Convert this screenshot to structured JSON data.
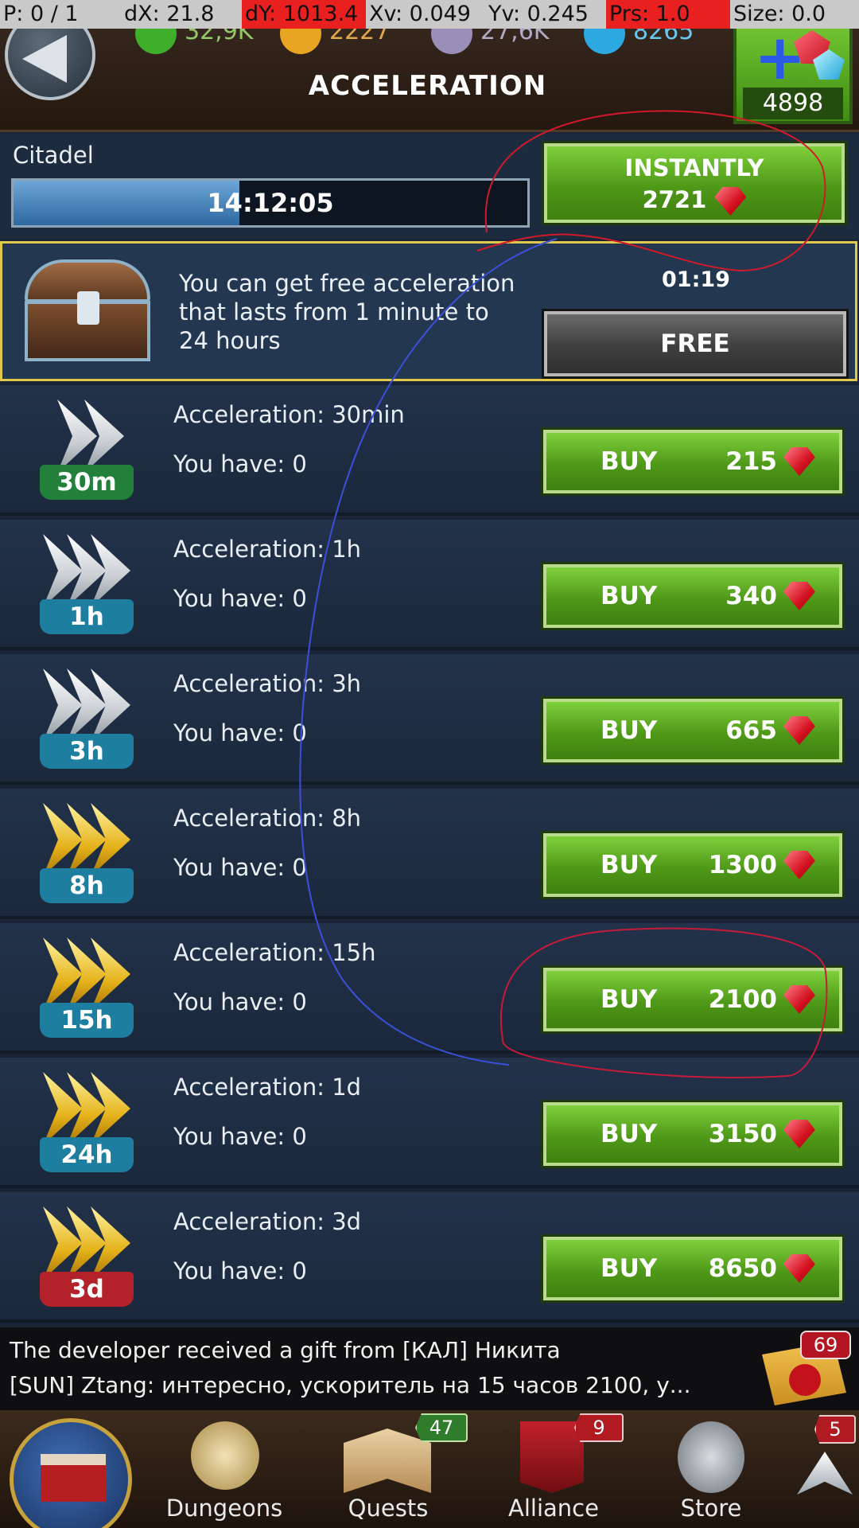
{
  "debug": {
    "pointer": "P: 0 / 1",
    "dx": "dX: 21.8",
    "dy": "dY: 1013.4",
    "xv": "Xv: 0.049",
    "yv": "Yv: 0.245",
    "prs": "Prs: 1.0",
    "size": "Size: 0.0"
  },
  "header": {
    "title": "ACCELERATION",
    "resources": [
      {
        "icon": "wood-icon",
        "value": "32,9K",
        "color": "#3fae2a"
      },
      {
        "icon": "gold-icon",
        "value": "2227",
        "color": "#e8a521"
      },
      {
        "icon": "stone-icon",
        "value": "27,6K",
        "color": "#9a8fb8"
      },
      {
        "icon": "mana-icon",
        "value": "8265",
        "color": "#2ba9e0"
      }
    ],
    "gems": "4898"
  },
  "citadel": {
    "label": "Citadel",
    "timer": "14:12:05",
    "progress": 0.44,
    "instant_label": "INSTANTLY",
    "instant_cost": "2721"
  },
  "free": {
    "text": "You can get free acceleration that lasts from 1 minute to 24 hours",
    "timer": "01:19",
    "button": "FREE"
  },
  "items": [
    {
      "name": "Acceleration: 30min",
      "have": "You have: 0",
      "tag": "30m",
      "tier": "silver",
      "arrows": 2,
      "tag_color": "#23803a",
      "buy": "BUY",
      "price": "215"
    },
    {
      "name": "Acceleration: 1h",
      "have": "You have: 0",
      "tag": "1h",
      "tier": "silver",
      "arrows": 3,
      "tag_color": "#1d7ea0",
      "buy": "BUY",
      "price": "340"
    },
    {
      "name": "Acceleration: 3h",
      "have": "You have: 0",
      "tag": "3h",
      "tier": "silver",
      "arrows": 3,
      "tag_color": "#1d7ea0",
      "buy": "BUY",
      "price": "665"
    },
    {
      "name": "Acceleration: 8h",
      "have": "You have: 0",
      "tag": "8h",
      "tier": "gold",
      "arrows": 3,
      "tag_color": "#1d7ea0",
      "buy": "BUY",
      "price": "1300"
    },
    {
      "name": "Acceleration: 15h",
      "have": "You have: 0",
      "tag": "15h",
      "tier": "gold",
      "arrows": 3,
      "tag_color": "#1d7ea0",
      "buy": "BUY",
      "price": "2100"
    },
    {
      "name": "Acceleration: 1d",
      "have": "You have: 0",
      "tag": "24h",
      "tier": "gold",
      "arrows": 3,
      "tag_color": "#1d7ea0",
      "buy": "BUY",
      "price": "3150"
    },
    {
      "name": "Acceleration: 3d",
      "have": "You have: 0",
      "tag": "3d",
      "tier": "gold",
      "arrows": 3,
      "tag_color": "#b3222a",
      "buy": "BUY",
      "price": "8650"
    }
  ],
  "chat": {
    "line1": "The developer received a gift from [КАЛ] Никита",
    "line2": "[SUN] Ztang: интересно, ускоритель на 15 часов 2100, у...",
    "mail_count": "69"
  },
  "nav": {
    "items": [
      {
        "label": "Dungeons",
        "badge": ""
      },
      {
        "label": "Quests",
        "badge": "47"
      },
      {
        "label": "Alliance",
        "badge": "9"
      },
      {
        "label": "Store",
        "badge": ""
      }
    ],
    "more_badge": "5"
  }
}
